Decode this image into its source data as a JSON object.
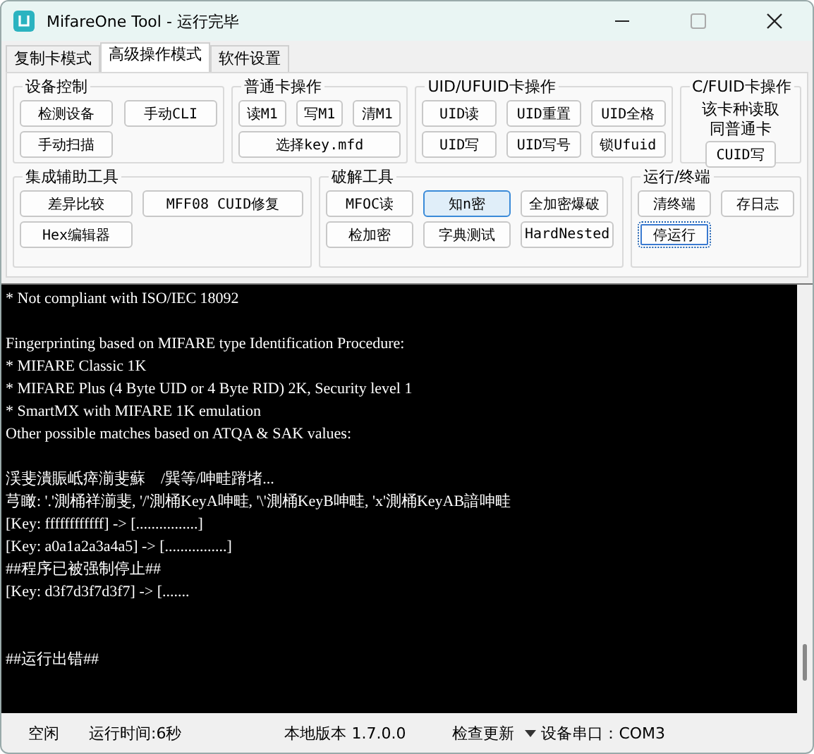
{
  "window": {
    "title": "MifareOne Tool - 运行完毕"
  },
  "tabs": [
    {
      "label": "复制卡模式",
      "selected": false
    },
    {
      "label": "高级操作模式",
      "selected": true
    },
    {
      "label": "软件设置",
      "selected": false
    }
  ],
  "top_groups": [
    {
      "title": "设备控制",
      "rows": [
        [
          {
            "label": "检测设备",
            "highlighted": false,
            "focused": false
          },
          {
            "label": "手动CLI",
            "highlighted": false,
            "focused": false
          }
        ],
        [
          {
            "label": "手动扫描",
            "highlighted": false,
            "focused": false
          }
        ]
      ]
    },
    {
      "title": "普通卡操作",
      "rows": [
        [
          {
            "label": "读M1",
            "highlighted": false,
            "focused": false
          },
          {
            "label": "写M1",
            "highlighted": false,
            "focused": false
          },
          {
            "label": "清M1",
            "highlighted": false,
            "focused": false
          }
        ]
      ],
      "wide_button": {
        "label": "选择key.mfd",
        "highlighted": false,
        "focused": false
      }
    },
    {
      "title": "UID/UFUID卡操作",
      "rows": [
        [
          {
            "label": "UID读",
            "highlighted": false,
            "focused": false
          },
          {
            "label": "UID重置",
            "highlighted": false,
            "focused": false
          },
          {
            "label": "UID全格",
            "highlighted": false,
            "focused": false
          }
        ],
        [
          {
            "label": "UID写",
            "highlighted": false,
            "focused": false
          },
          {
            "label": "UID写号",
            "highlighted": false,
            "focused": false
          },
          {
            "label": "锁Ufuid",
            "highlighted": false,
            "focused": false
          }
        ]
      ]
    },
    {
      "title": "C/FUID卡操作",
      "note_lines": [
        "该卡种读取",
        "同普通卡"
      ],
      "rows": [
        [
          {
            "label": "CUID写",
            "highlighted": false,
            "focused": false
          }
        ]
      ]
    }
  ],
  "bottom_groups": [
    {
      "title": "集成辅助工具",
      "rows": [
        [
          {
            "label": "差异比较",
            "highlighted": false,
            "focused": false
          },
          {
            "label": "MFF08 CUID修复",
            "highlighted": false,
            "focused": false
          }
        ],
        [
          {
            "label": "Hex编辑器",
            "highlighted": false,
            "focused": false
          }
        ]
      ]
    },
    {
      "title": "破解工具",
      "rows": [
        [
          {
            "label": "MFOC读",
            "highlighted": false,
            "focused": false
          },
          {
            "label": "知n密",
            "highlighted": true,
            "focused": false
          },
          {
            "label": "全加密爆破",
            "highlighted": false,
            "focused": false
          }
        ],
        [
          {
            "label": "检加密",
            "highlighted": false,
            "focused": false
          },
          {
            "label": "字典测试",
            "highlighted": false,
            "focused": false
          },
          {
            "label": "HardNested",
            "highlighted": false,
            "focused": false
          }
        ]
      ]
    },
    {
      "title": "运行/终端",
      "rows": [
        [
          {
            "label": "清终端",
            "highlighted": false,
            "focused": false
          },
          {
            "label": "存日志",
            "highlighted": false,
            "focused": false
          }
        ],
        [
          {
            "label": "停运行",
            "highlighted": false,
            "focused": true
          }
        ]
      ]
    }
  ],
  "terminal_text": "* Not compliant with ISO/IEC 18092\n\nFingerprinting based on MIFARE type Identification Procedure:\n* MIFARE Classic 1K\n* MIFARE Plus (4 Byte UID or 4 Byte RID) 2K, Security level 1\n* SmartMX with MIFARE 1K emulation\nOther possible matches based on ATQA & SAK values:\n\n渓斐潰賑岻瘁湔斐蘇    /巽等/呻畦蹐堵...\n芎瞰: '.'測桶祥湔斐, '/'測桶KeyA呻畦, '\\'測桶KeyB呻畦, 'x'測桶KeyAB諳呻畦\n[Key: ffffffffffff] -> [................]\n[Key: a0a1a2a3a4a5] -> [................]\n##程序已被强制停止##\n[Key: d3f7d3f7d3f7] -> [.......\n\n\n##运行出错##",
  "status_bar": {
    "state": "空闲",
    "runtime": "运行时间:6秒",
    "version": "本地版本 1.7.0.0",
    "update": "检查更新",
    "port": "设备串口：COM3"
  }
}
